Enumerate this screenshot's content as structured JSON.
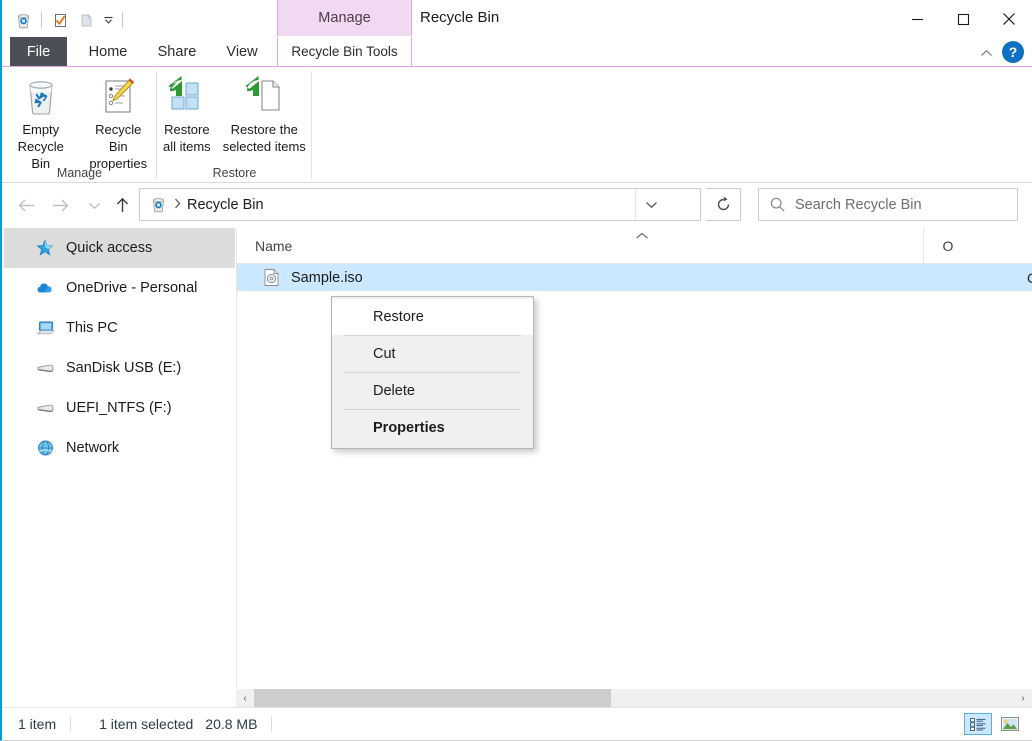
{
  "window": {
    "title": "Recycle Bin",
    "contextual_tab_header": "Manage",
    "minimize_label": "Minimize",
    "maximize_label": "Maximize",
    "close_label": "Close",
    "help_label": "?"
  },
  "quick_access_toolbar": {
    "items": [
      {
        "name": "recycle-bin-icon",
        "label": "Recycle Bin properties"
      },
      {
        "name": "properties-icon",
        "label": "Properties"
      },
      {
        "name": "new-folder-icon",
        "label": "New folder"
      }
    ],
    "customize_label": "Customize Quick Access Toolbar"
  },
  "tabs": [
    {
      "id": "file",
      "label": "File"
    },
    {
      "id": "home",
      "label": "Home"
    },
    {
      "id": "share",
      "label": "Share"
    },
    {
      "id": "view",
      "label": "View"
    },
    {
      "id": "recycle-bin-tools",
      "label": "Recycle Bin Tools",
      "active": true
    }
  ],
  "ribbon": {
    "groups": [
      {
        "id": "manage",
        "label": "Manage",
        "buttons": [
          {
            "id": "empty-recycle-bin",
            "label": "Empty\nRecycle Bin"
          },
          {
            "id": "recycle-bin-properties",
            "label": "Recycle Bin\nproperties"
          }
        ]
      },
      {
        "id": "restore",
        "label": "Restore",
        "buttons": [
          {
            "id": "restore-all-items",
            "label": "Restore\nall items"
          },
          {
            "id": "restore-the-selected-items",
            "label": "Restore the\nselected items"
          }
        ]
      }
    ]
  },
  "navigation": {
    "back_label": "Back",
    "forward_label": "Forward",
    "recent_label": "Recent locations",
    "up_label": "Up",
    "address": {
      "icon": "recycle-bin-icon",
      "crumb": "Recycle Bin",
      "dropdown_label": "Previous locations"
    },
    "refresh_label": "Refresh",
    "search": {
      "placeholder": "Search Recycle Bin",
      "icon": "search-icon"
    }
  },
  "nav_pane": {
    "items": [
      {
        "id": "quick-access",
        "label": "Quick access",
        "icon": "star-icon",
        "selected": true
      },
      {
        "id": "onedrive-personal",
        "label": "OneDrive - Personal",
        "icon": "cloud-icon",
        "selected": false
      },
      {
        "id": "this-pc",
        "label": "This PC",
        "icon": "monitor-icon",
        "selected": false
      },
      {
        "id": "sandisk-usb-e",
        "label": "SanDisk USB (E:)",
        "icon": "usb-drive-icon",
        "selected": false
      },
      {
        "id": "uefi-ntfs-f",
        "label": "UEFI_NTFS (F:)",
        "icon": "usb-drive-icon",
        "selected": false
      },
      {
        "id": "network",
        "label": "Network",
        "icon": "network-icon",
        "selected": false
      }
    ]
  },
  "file_list": {
    "columns": [
      {
        "id": "name",
        "label": "Name",
        "sorted": "ascending"
      },
      {
        "id": "original-location",
        "label": "O"
      }
    ],
    "rows": [
      {
        "name": "Sample.iso",
        "icon": "disc-image-icon",
        "col2": "C",
        "selected": true
      }
    ]
  },
  "context_menu": {
    "items": [
      {
        "id": "restore",
        "label": "Restore",
        "hovered": true,
        "bold": false
      },
      {
        "id": "cut",
        "label": "Cut",
        "hovered": false,
        "bold": false
      },
      {
        "id": "delete",
        "label": "Delete",
        "hovered": false,
        "bold": false
      },
      {
        "id": "properties",
        "label": "Properties",
        "hovered": false,
        "bold": true
      }
    ]
  },
  "scrollbar": {
    "left_arrow": "‹",
    "right_arrow": "›",
    "thumb_fraction": 0.47
  },
  "status_bar": {
    "item_count": "1 item",
    "selection": "1 item selected",
    "size": "20.8 MB",
    "views": [
      {
        "id": "details-view",
        "label": "Details view",
        "active": true
      },
      {
        "id": "large-icons-view",
        "label": "Large icons view",
        "active": false
      }
    ]
  },
  "colors": {
    "accent_border": "#0a9bd8",
    "contextual_tab": "#f2d9f2",
    "contextual_tab_border": "#e0a8e0",
    "selection": "#cce8ff",
    "file_tab": "#4a5056",
    "help_blue": "#0c72c0"
  }
}
